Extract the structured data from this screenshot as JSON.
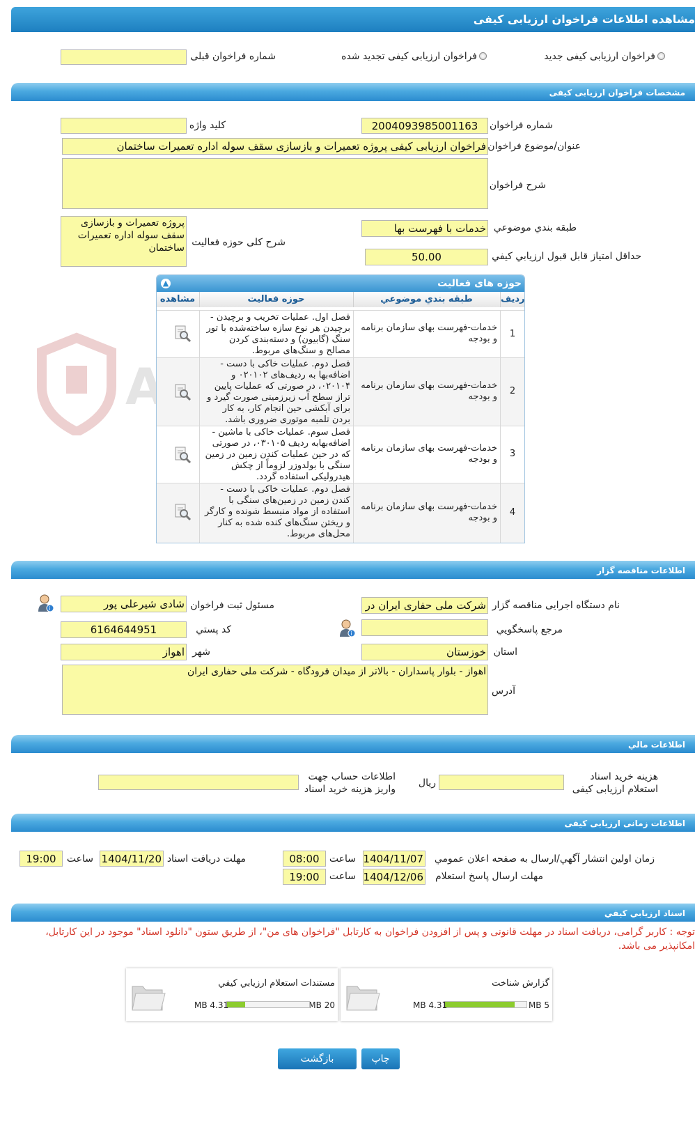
{
  "page_title": "مشاهده اطلاعات فراخوان ارزیابی کیفی",
  "type_options": {
    "new": "فراخوان ارزیابی کیفی جدید",
    "renewed": "فراخوان ارزیابی کیفی تجدید شده",
    "prev_number_label": "شماره فراخوان قبلی",
    "prev_number_value": ""
  },
  "sec_spec": {
    "title": "مشخصات فراخوان ارزیابی کیفی",
    "number_label": "شماره فراخوان",
    "number_value": "2004093985001163",
    "keyword_label": "کلید واژه",
    "keyword_value": "",
    "subject_label": "عنوان/موضوع فراخوان",
    "subject_value": "فراخوان ارزیابی کیفی پروژه تعمیرات و بازسازی سقف سوله اداره تعمیرات ساختمان",
    "desc_label": "شرح فراخوان",
    "desc_value": "",
    "category_label": "طبقه بندي موضوعي",
    "category_value": "خدمات با فهرست بها",
    "activity_desc_label": "شرح کلی حوزه فعالیت",
    "activity_desc_value": "پروژه تعمیرات و بازسازی سقف سوله اداره تعمیرات ساختمان",
    "min_score_label": "حداقل امتياز قابل قبول ارزيابي كيفي",
    "min_score_value": "50.00"
  },
  "activity_table": {
    "title": "حوزه های فعالیت",
    "columns": [
      "رديف",
      "طبقه بندي موضوعي",
      "حوزه فعالیت",
      "مشاهده"
    ],
    "rows": [
      {
        "idx": "1",
        "category": "خدمات-فهرست بهای سازمان برنامه و بودجه",
        "activity": "فصل اول. عملیات تخریب و برچیدن - برچیدن هر نوع سازه ساخته‌شده با تور سنگ (گابیون) و دسته‌بندی کردن مصالح و سنگ‌های مربوط."
      },
      {
        "idx": "2",
        "category": "خدمات-فهرست بهای سازمان برنامه و بودجه",
        "activity": "فصل دوم. عملیات خاکی با دست - اضافه‌بها به ردیف‌های ۰۲۰۱۰۲ و ۰۲۰۱۰۴، در صورتی که عملیات پایین تراز سطح آب زیرزمینی صورت گیرد و برای آبکشی حین انجام کار، به کار بردن تلمبه موتوری ضروری باشد."
      },
      {
        "idx": "3",
        "category": "خدمات-فهرست بهای سازمان برنامه و بودجه",
        "activity": "فصل سوم. عملیات خاکی با ماشین - اضافه‌بهابه ردیف ۰۳۰۱۰۵، در صورتی که در حین عملیات کندن زمین در زمین سنگی با بولدوزر لزوماً از چکش هیدرولیکی استفاده گردد."
      },
      {
        "idx": "4",
        "category": "خدمات-فهرست بهای سازمان برنامه و بودجه",
        "activity": "فصل دوم. عملیات خاکی با دست - کندن زمین در زمین‌های سنگی با استفاده از مواد منبسط شونده و کارگر و ریختن سنگ‌های کنده شده به کنار محل‌های مربوط."
      }
    ]
  },
  "sec_org": {
    "title": "اطلاعات مناقصه گزار",
    "org_label": "نام دستگاه اجرایی مناقصه گزار",
    "org_value": "شرکت ملی حفاری ایران در",
    "registrar_label": "مسئول ثبت فراخوان",
    "registrar_value": "شادی شیرعلی پور",
    "respondent_label": "مرجع پاسخگويي",
    "respondent_value": "",
    "postal_label": "کد پستي",
    "postal_value": "6164644951",
    "province_label": "استان",
    "province_value": "خوزستان",
    "city_label": "شهر",
    "city_value": "اهواز",
    "address_label": "آدرس",
    "address_value": "اهواز - بلوار پاسداران - بالاتر از میدان فرودگاه - شرکت ملی حفاری ایران"
  },
  "sec_fin": {
    "title": "اطلاعات مالي",
    "cost_label": "هزینه خرید اسناد استعلام ارزیابی کیفی",
    "cost_value": "",
    "cost_unit": "ريال",
    "account_label": "اطلاعات حساب جهت واریز هزینه خرید اسناد",
    "account_value": ""
  },
  "sec_time": {
    "title": "اطلاعات زمانی ارزیابی کیفی",
    "publish_label": "زمان اولين انتشار آگهي/ارسال به صفحه اعلان عمومي",
    "publish_date": "1404/11/07",
    "publish_time": "08:00",
    "receive_label": "مهلت دریافت اسناد",
    "receive_date": "1404/11/20",
    "receive_time": "19:00",
    "response_label": "مهلت ارسال پاسخ استعلام",
    "response_date": "1404/12/06",
    "response_time": "19:00",
    "time_label": "ساعت"
  },
  "sec_docs": {
    "title": "اسناد ارزيابي کيفي",
    "notice": "توجه : کاربر گرامی، دریافت اسناد در مهلت قانونی و پس از افزودن فراخوان به کارتابل \"فراخوان های من\"، از طریق ستون \"دانلود اسناد\" موجود در این کارتابل، امکانپذیر می باشد.",
    "docs": [
      {
        "name": "گزارش شناخت",
        "max": "5 MB",
        "size": "4.31 MB",
        "fill": 0.86
      },
      {
        "name": "مستندات استعلام ارزيابي کيفي",
        "max": "20 MB",
        "size": "4.31 MB",
        "fill": 0.22
      }
    ]
  },
  "buttons": {
    "print": "چاپ",
    "back": "بازگشت"
  },
  "watermark_text": "AriaTender.neT",
  "colors": {
    "header_blue": "#1d7fc0",
    "field_yellow": "#fafaa5",
    "warning_red": "#d4372a",
    "progress_green": "#8ccc2e"
  }
}
